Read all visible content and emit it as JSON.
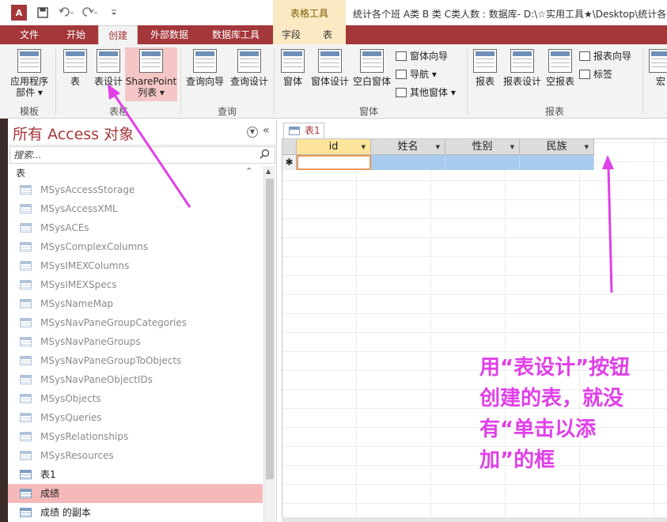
{
  "titlebar": {
    "app_logo": "A",
    "qat": {
      "save_icon": "save-icon",
      "undo_icon": "undo-icon",
      "redo_icon": "redo-icon",
      "customize_icon": "customize-icon"
    },
    "context_group": "表格工具",
    "window_title": "统计各个班 A类 B 类 C类人数 : 数据库- D:\\☆实用工具★\\Desktop\\统计各"
  },
  "tabs": {
    "file": "文件",
    "home": "开始",
    "create": "创建",
    "external": "外部数据",
    "dbtools": "数据库工具",
    "fields": "字段",
    "table": "表"
  },
  "ribbon": {
    "templates": {
      "app_parts": "应用程序",
      "app_parts_2": "部件 ▾",
      "group": "模板"
    },
    "tables": {
      "table": "表",
      "table_design": "表设计",
      "sharepoint": "SharePoint",
      "sharepoint_2": "列表 ▾",
      "group": "表格"
    },
    "queries": {
      "wizard": "查询向导",
      "design": "查询设计",
      "group": "查询"
    },
    "forms": {
      "form": "窗体",
      "form_design": "窗体设计",
      "blank_form": "空白窗体",
      "form_wizard": "窗体向导",
      "navigation": "导航 ▾",
      "more_forms": "其他窗体 ▾",
      "group": "窗体"
    },
    "reports": {
      "report": "报表",
      "report_design": "报表设计",
      "blank_report": "空报表",
      "report_wizard": "报表向导",
      "labels": "标签",
      "group": "报表"
    },
    "macros": {
      "macro": "宏"
    }
  },
  "nav": {
    "title": "所有 Access 对象",
    "menu_icon": "chevron-down-icon",
    "collapse": "«",
    "search_placeholder": "搜索...",
    "search_icon": "search-icon",
    "group_label": "表",
    "group_toggle": "⌃",
    "items": [
      {
        "label": "MSysAccessStorage",
        "kind": "sys"
      },
      {
        "label": "MSysAccessXML",
        "kind": "sys"
      },
      {
        "label": "MSysACEs",
        "kind": "sys"
      },
      {
        "label": "MSysComplexColumns",
        "kind": "sys"
      },
      {
        "label": "MSysIMEXColumns",
        "kind": "sys"
      },
      {
        "label": "MSysIMEXSpecs",
        "kind": "sys"
      },
      {
        "label": "MSysNameMap",
        "kind": "sys"
      },
      {
        "label": "MSysNavPaneGroupCategories",
        "kind": "sys"
      },
      {
        "label": "MSysNavPaneGroups",
        "kind": "sys"
      },
      {
        "label": "MSysNavPaneGroupToObjects",
        "kind": "sys"
      },
      {
        "label": "MSysNavPaneObjectIDs",
        "kind": "sys"
      },
      {
        "label": "MSysObjects",
        "kind": "sys"
      },
      {
        "label": "MSysQueries",
        "kind": "sys"
      },
      {
        "label": "MSysRelationships",
        "kind": "sys"
      },
      {
        "label": "MSysResources",
        "kind": "sys"
      },
      {
        "label": "表1",
        "kind": "user"
      },
      {
        "label": "成绩",
        "kind": "selected"
      },
      {
        "label": "成绩 的副本",
        "kind": "user"
      }
    ]
  },
  "doc": {
    "tab_label": "表1",
    "new_row_marker": "✱",
    "columns": [
      "id",
      "姓名",
      "性别",
      "民族"
    ]
  },
  "annotation": {
    "text": "用“表设计”按钮创建的表，就没有“单击以添加”的框",
    "color": "#e040e8"
  },
  "colors": {
    "accent": "#a4373a",
    "selected_row": "#f5b9b9"
  }
}
